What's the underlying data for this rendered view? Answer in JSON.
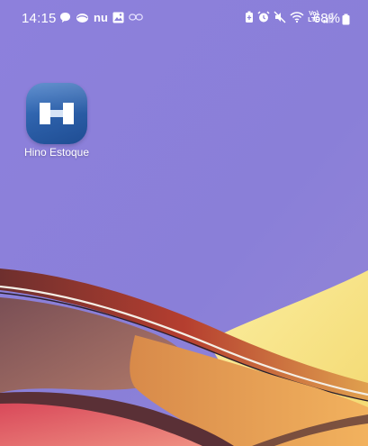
{
  "status_bar": {
    "time": "14:15",
    "battery_percent": "68%",
    "left_icons": [
      "chat-bubble-icon",
      "cloud-icon",
      "nu-app-icon",
      "gallery-icon",
      "link-icon"
    ],
    "right_icons": [
      "battery-saver-icon",
      "alarm-icon",
      "mute-icon",
      "wifi-icon",
      "volte-lte-icon",
      "signal-icon",
      "battery-icon"
    ],
    "nu_text": "nu",
    "volte_text": "Vo)\nLTE"
  },
  "home": {
    "apps": [
      {
        "label": "Hino Estoque",
        "icon": "hino-estoque-icon",
        "accent": "#2f66b0"
      }
    ]
  },
  "wallpaper": {
    "colors": {
      "sky": "#8a7fd9",
      "yellow": "#f6e48a",
      "orange": "#f0a85a",
      "brown": "#8a5a55",
      "red": "#c9483e",
      "pink": "#e9907e"
    }
  }
}
